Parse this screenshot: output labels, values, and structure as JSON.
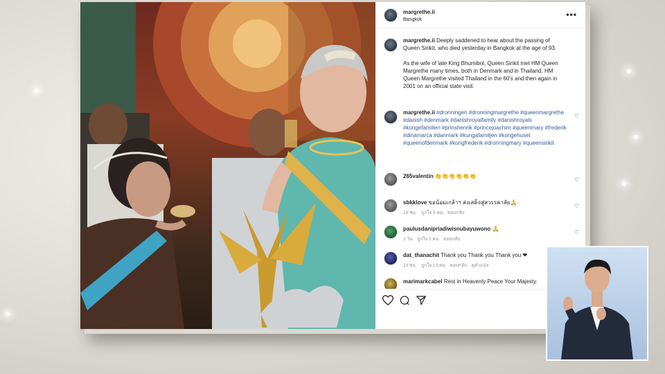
{
  "post": {
    "username": "margrethe.ii",
    "location": "Bangkok",
    "caption": {
      "username": "margrethe.ii",
      "paragraph1": "Deeply saddened to hear about the passing of Queen Sirikit, who died yesterday in Bangkok at the age of 93.",
      "paragraph2": "As the wife of late King Bhumibol, Queen Sirikit met HM Queen Margrethe many times, both in Denmark and in Thailand. HM Queen Margrethe visited Thailand in the 60's and then again in 2001 on an official state visit."
    },
    "hashtags": {
      "username": "margrethe.ii",
      "text": "#dronningen #dronningmargrethe #queenmargrethe #danish #denmark #danishroyalfamily #danishroyals #kongefamilien #prinshenrik #princejoachim #queenmary #frederik #dinamarca #danmark #kungafamiljen #kongehuset #queenofdenmark #kongfrederik #dronningmary #queensirikit"
    }
  },
  "comments": [
    {
      "username": "265valentin",
      "text": "👏👏👏👏👏👏",
      "meta": []
    },
    {
      "username": "sbkklove",
      "text": "ขอน้อมเกล้าฯ ส่งเสด็จสู่สวรรคาลัย🙏",
      "meta": [
        "14 ชม.",
        "ถูกใจ 5 คน",
        "ตอบกลับ"
      ]
    },
    {
      "username": "paulusdanipriadiwisnubayuwono",
      "text": "🙏",
      "meta": [
        "1 วัน",
        "ถูกใจ 2 คน",
        "ตอบกลับ"
      ]
    },
    {
      "username": "dat_thanachit",
      "text": "Thank you Thank you Thank you ❤",
      "meta": [
        "13 ชม.",
        "ถูกใจ 13 คน",
        "ตอบกลับ",
        "ดูคำแปล"
      ]
    },
    {
      "username": "marimarkcabel",
      "text": "Rest in Heavenly Peace Your Majesty.",
      "meta": []
    }
  ],
  "icons": {
    "more": "more-options-icon",
    "like": "heart-icon",
    "comment": "comment-icon",
    "share": "share-icon",
    "next": "chevron-right-icon"
  },
  "colors": {
    "hashtag": "#385a94",
    "meta": "#8e8e8e",
    "text": "#262626"
  }
}
